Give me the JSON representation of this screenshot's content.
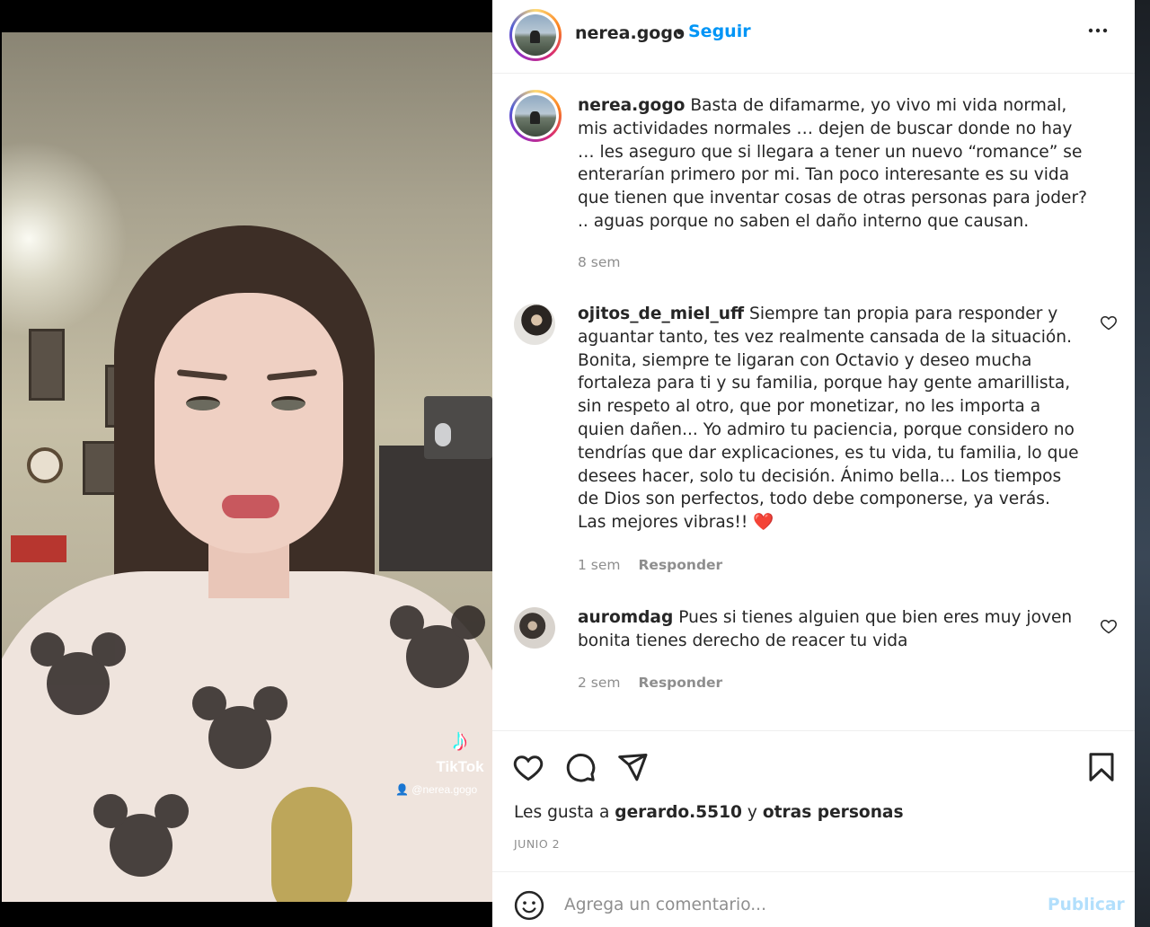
{
  "post": {
    "username": "nerea.gogo",
    "separator": "•",
    "follow_label": "Seguir",
    "more_label": "•••"
  },
  "media": {
    "watermark_brand": "TikTok",
    "watermark_handle": "@nerea.gogo"
  },
  "caption": {
    "username": "nerea.gogo",
    "text": "Basta de difamarme, yo vivo mi vida normal, mis actividades normales … dejen de buscar donde no hay … les aseguro que si llegara a tener un nuevo “romance” se enterarían primero por mi. Tan poco interesante es su vida que tienen que inventar cosas de otras personas para joder? .. aguas porque no saben el daño interno que causan.",
    "time": "8 sem"
  },
  "comments": [
    {
      "username": "ojitos_de_miel_uff",
      "text": "Siempre tan propia para responder y aguantar tanto, tes vez realmente cansada de la situación. Bonita, siempre te ligaran con Octavio y deseo mucha fortaleza para ti y su familia, porque hay gente amarillista, sin respeto al otro, que por monetizar, no les importa a quien dañen... Yo admiro tu paciencia, porque considero no tendrías que dar explicaciones, es tu vida, tu familia, lo que desees hacer, solo tu decisión. Ánimo bella... Los tiempos de Dios son perfectos, todo debe componerse, ya verás. Las mejores vibras!! ❤️",
      "time": "1 sem",
      "reply_label": "Responder"
    },
    {
      "username": "auromdag",
      "text": "Pues si tienes alguien que bien eres muy joven bonita tienes derecho de reacer tu vida",
      "time": "2 sem",
      "reply_label": "Responder"
    }
  ],
  "likes": {
    "prefix": "Les gusta a",
    "user": "gerardo.5510",
    "joiner": "y",
    "others": "otras personas"
  },
  "date": "JUNIO 2",
  "composer": {
    "placeholder": "Agrega un comentario...",
    "publish_label": "Publicar"
  },
  "colors": {
    "link_blue": "#0095f6",
    "publish_disabled": "#b2dffc",
    "secondary_text": "#8e8e8e"
  },
  "icons": [
    "more-options-icon",
    "heart-icon",
    "comment-icon",
    "share-icon",
    "bookmark-icon",
    "emoji-icon"
  ]
}
